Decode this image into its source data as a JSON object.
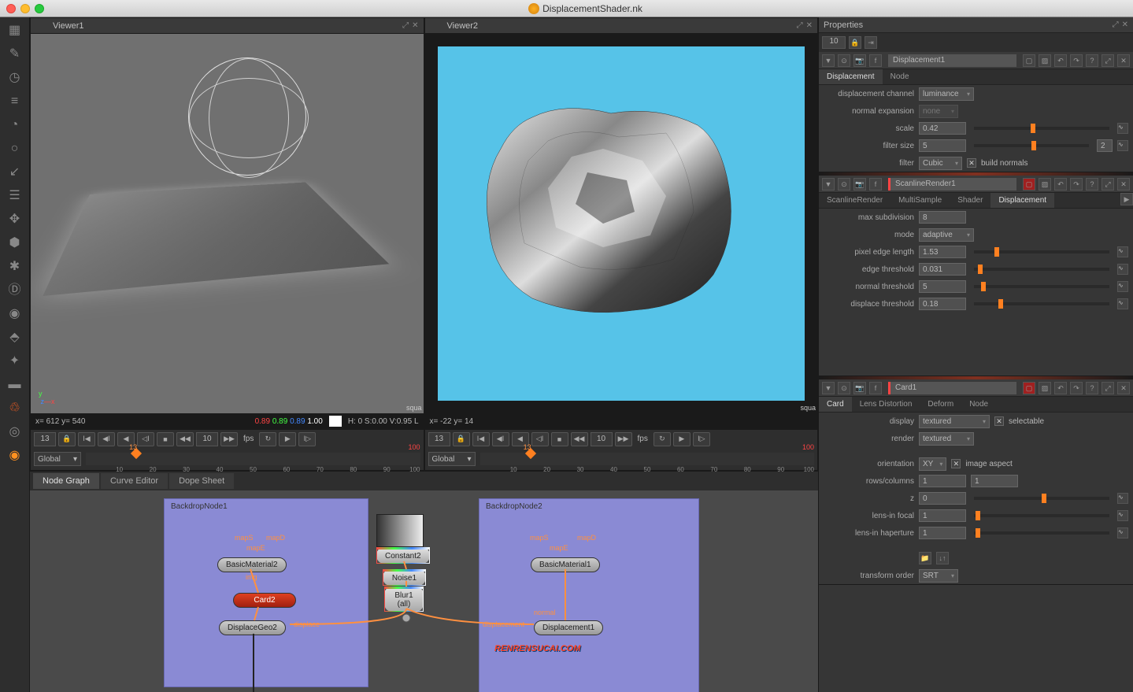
{
  "title": "DisplacementShader.nk",
  "viewer1": {
    "name": "Viewer1",
    "coords": "x= 612 y= 540",
    "rgba_r": "0.89",
    "rgba_g": "0.89",
    "rgba_b": "0.89",
    "rgba_a": "1.00",
    "hsv": "H:  0 S:0.00 V:0.95  L",
    "corner": "squa",
    "frame": "13",
    "fps_num": "10",
    "fps_lbl": "fps",
    "scope": "Global",
    "playhead": "13",
    "ticks": [
      "10",
      "20",
      "30",
      "40",
      "50",
      "60",
      "70",
      "80",
      "90",
      "100"
    ],
    "end": "100"
  },
  "viewer2": {
    "name": "Viewer2",
    "coords": "x= -22 y=  14",
    "corner": "squa",
    "frame": "13",
    "fps_num": "10",
    "fps_lbl": "fps",
    "scope": "Global",
    "playhead": "13",
    "ticks": [
      "10",
      "20",
      "30",
      "40",
      "50",
      "60",
      "70",
      "80",
      "90",
      "100"
    ],
    "end": "100"
  },
  "bottom_tabs": [
    "Node Graph",
    "Curve Editor",
    "Dope Sheet"
  ],
  "nodes": {
    "bd1": "BackdropNode1",
    "bd2": "BackdropNode2",
    "mapS": "mapS",
    "mapD": "mapD",
    "mapE": "mapE",
    "basicmat2": "BasicMaterial2",
    "img": "img",
    "card2": "Card2",
    "dispgeo2": "DisplaceGeo2",
    "displace_lbl": "displace",
    "constant2": "Constant2",
    "noise1": "Noise1",
    "blur1": "Blur1",
    "blur_all": "(all)",
    "basicmat1": "BasicMaterial1",
    "normal": "normal",
    "displacement_lbl": "displacement",
    "disp1": "Displacement1",
    "watermark": "RENRENSUCAI.COM"
  },
  "properties": {
    "title": "Properties",
    "count": "10",
    "p1": {
      "name": "Displacement1",
      "tabs": [
        "Displacement",
        "Node"
      ],
      "rows": {
        "disp_channel_lbl": "displacement channel",
        "disp_channel": "luminance",
        "norm_exp_lbl": "normal expansion",
        "norm_exp": "none",
        "scale_lbl": "scale",
        "scale": "0.42",
        "filter_size_lbl": "filter size",
        "filter_size": "5",
        "filter_size2": "2",
        "filter_lbl": "filter",
        "filter": "Cubic",
        "build_normals": "build normals"
      }
    },
    "p2": {
      "name": "ScanlineRender1",
      "tabs": [
        "ScanlineRender",
        "MultiSample",
        "Shader",
        "Displacement"
      ],
      "active_tab": 3,
      "rows": {
        "max_sub_lbl": "max subdivision",
        "max_sub": "8",
        "mode_lbl": "mode",
        "mode": "adaptive",
        "pel_lbl": "pixel edge length",
        "pel": "1.53",
        "et_lbl": "edge threshold",
        "et": "0.031",
        "nt_lbl": "normal threshold",
        "nt": "5",
        "dt_lbl": "displace threshold",
        "dt": "0.18"
      }
    },
    "p3": {
      "name": "Card1",
      "tabs": [
        "Card",
        "Lens Distortion",
        "Deform",
        "Node"
      ],
      "rows": {
        "display_lbl": "display",
        "display": "textured",
        "selectable": "selectable",
        "render_lbl": "render",
        "render": "textured",
        "orient_lbl": "orientation",
        "orient": "XY",
        "image_aspect": "image aspect",
        "rc_lbl": "rows/columns",
        "rows": "1",
        "cols": "1",
        "z_lbl": "z",
        "z": "0",
        "lif_lbl": "lens-in focal",
        "lif": "1",
        "lih_lbl": "lens-in haperture",
        "lih": "1",
        "to_lbl": "transform order",
        "to": "SRT"
      }
    }
  }
}
